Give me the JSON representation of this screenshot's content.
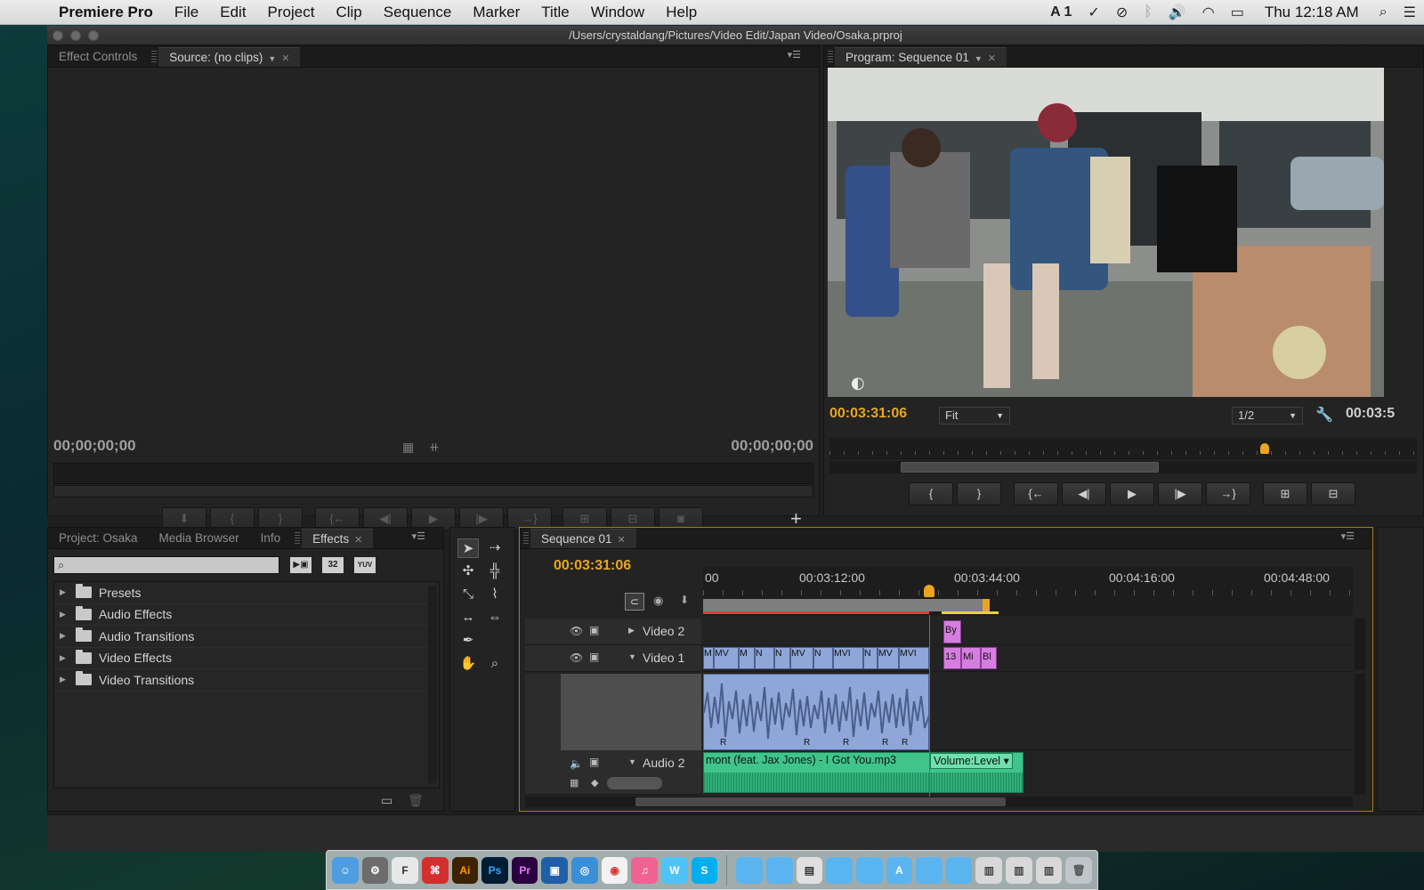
{
  "menubar": {
    "app_name": "Premiere Pro",
    "items": [
      "File",
      "Edit",
      "Project",
      "Clip",
      "Sequence",
      "Marker",
      "Title",
      "Window",
      "Help"
    ],
    "status": {
      "adobe_badge": "1",
      "clock": "Thu 12:18 AM"
    }
  },
  "window": {
    "title": "/Users/crystaldang/Pictures/Video Edit/Japan Video/Osaka.prproj"
  },
  "source_panel": {
    "tabs": {
      "effect_controls": "Effect Controls",
      "source": "Source: (no clips)"
    },
    "timecode_in": "00;00;00;00",
    "timecode_out": "00;00;00;00"
  },
  "program_panel": {
    "tab": "Program: Sequence 01",
    "timecode": "00:03:31:06",
    "timecode_right": "00:03:5",
    "fit": "Fit",
    "resolution": "1/2"
  },
  "project_panel": {
    "tabs": {
      "project": "Project: Osaka",
      "media_browser": "Media Browser",
      "info": "Info",
      "effects": "Effects"
    },
    "search_placeholder": "",
    "filter_buttons": {
      "accelerated": "",
      "bit32": "32",
      "yuv": "YUV"
    },
    "tree": [
      {
        "label": "Presets",
        "starred": true
      },
      {
        "label": "Audio Effects"
      },
      {
        "label": "Audio Transitions"
      },
      {
        "label": "Video Effects"
      },
      {
        "label": "Video Transitions"
      }
    ]
  },
  "timeline": {
    "tab": "Sequence 01",
    "timecode": "00:03:31:06",
    "ruler": {
      "start": "00",
      "t1": "00:03:12:00",
      "t2": "00:03:44:00",
      "t3": "00:04:16:00",
      "t4": "00:04:48:00"
    },
    "tracks": {
      "video2": "Video 2",
      "video1": "Video 1",
      "audio2": "Audio 2"
    },
    "clips": {
      "v2_clip": "By",
      "v1_clips": [
        "M",
        "MV",
        "M",
        "N",
        "N",
        "MV",
        "N",
        "MVI",
        "N",
        "MV",
        "MVI"
      ],
      "v1_pink": [
        "13",
        "Mi",
        "Bl"
      ],
      "audio_clip": "mont (feat. Jax Jones) - I Got You.mp3",
      "volume": "Volume:Level",
      "audio_markers": [
        "R",
        "R",
        "R",
        "R",
        "R"
      ]
    }
  },
  "colors": {
    "timecode": "#e8a61c",
    "playhead": "#e23b3b",
    "video_clip": "#8fa6d8",
    "pink_clip": "#d67ee0",
    "audio_clip": "#3fc58a"
  }
}
